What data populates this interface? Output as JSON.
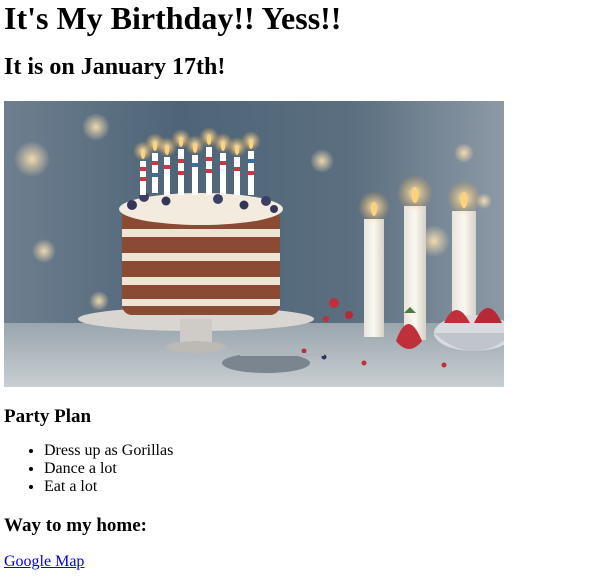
{
  "page": {
    "title": "It's My Birthday!! Yess!!",
    "subtitle": "It is on January 17th!"
  },
  "hero_image": {
    "subject": "birthday-cake-with-candles",
    "colors": {
      "background_blue": "#5f7487",
      "cake_sponge": "#8a4a34",
      "frosting": "#f1e6d8",
      "candle_flame": "#ffd27a",
      "strawberry": "#c0303a"
    }
  },
  "party_plan": {
    "heading": "Party Plan",
    "items": [
      "Dress up as Gorillas",
      "Dance a lot",
      "Eat a lot"
    ]
  },
  "directions": {
    "heading": "Way to my home:",
    "link_label": "Google Map"
  }
}
